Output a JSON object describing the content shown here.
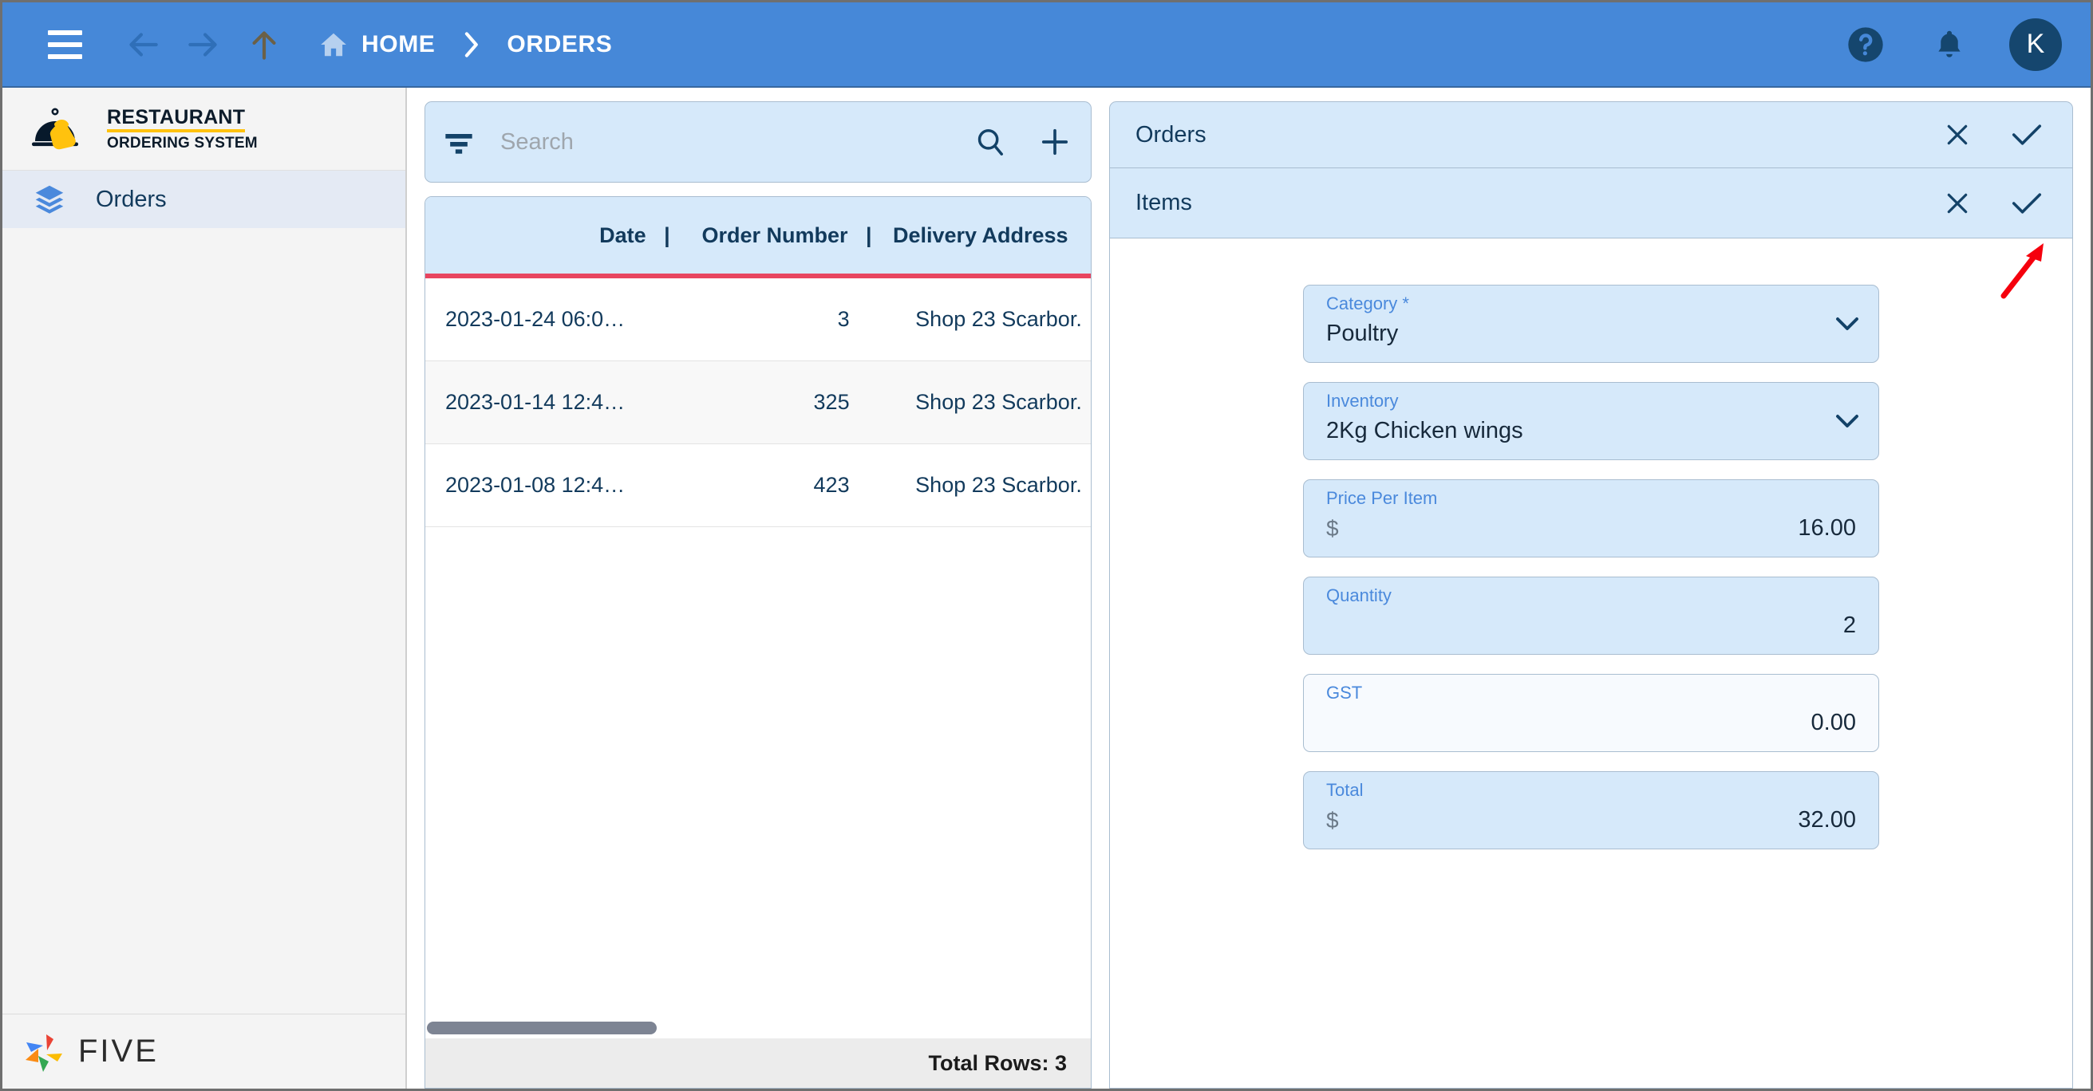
{
  "topbar": {
    "menu_icon": "hamburger-icon",
    "back_icon": "arrow-left-icon",
    "forward_icon": "arrow-right-icon",
    "up_icon": "arrow-up-icon",
    "home_icon": "home-icon",
    "breadcrumb": [
      "HOME",
      "ORDERS"
    ],
    "separator": ">",
    "help_icon": "help-circle-icon",
    "notifications_icon": "bell-icon",
    "avatar_initial": "K",
    "background_color": "#4688d8",
    "avatar_color": "#15466e"
  },
  "sidebar": {
    "logo": {
      "icon": "cloche-hand-icon",
      "line1": "RESTAURANT",
      "line2": "ORDERING SYSTEM",
      "underline_color": "#ffc20e"
    },
    "items": [
      {
        "icon": "layers-icon",
        "label": "Orders",
        "active": true
      }
    ],
    "footer_logo": {
      "icon": "five-pinwheel-icon",
      "text": "FIVE"
    }
  },
  "list_panel": {
    "search": {
      "filter_icon": "filter-icon",
      "placeholder": "Search",
      "value": "",
      "search_icon": "search-icon",
      "add_icon": "plus-icon"
    },
    "table": {
      "columns": [
        "Date",
        "Order Number",
        "Delivery Address"
      ],
      "column_separator": "|",
      "accent_color": "#e8455f",
      "rows": [
        {
          "date": "2023-01-24 06:0…",
          "order_number": "3",
          "delivery_address": "Shop 23 Scarbor."
        },
        {
          "date": "2023-01-14 12:4…",
          "order_number": "325",
          "delivery_address": "Shop 23 Scarbor."
        },
        {
          "date": "2023-01-08 12:4…",
          "order_number": "423",
          "delivery_address": "Shop 23 Scarbor."
        }
      ],
      "footer": "Total Rows: 3"
    }
  },
  "detail_panel": {
    "orders_panel": {
      "title": "Orders",
      "cancel_icon": "close-x-icon",
      "confirm_icon": "checkmark-icon"
    },
    "items_panel": {
      "title": "Items",
      "cancel_icon": "close-x-icon",
      "confirm_icon": "checkmark-icon"
    },
    "fields": [
      {
        "label": "Category *",
        "value": "Poultry",
        "type": "select",
        "currency": "",
        "readonly": false
      },
      {
        "label": "Inventory",
        "value": "2Kg Chicken wings",
        "type": "select",
        "currency": "",
        "readonly": false
      },
      {
        "label": "Price Per Item",
        "value": "16.00",
        "type": "currency",
        "currency": "$",
        "readonly": false
      },
      {
        "label": "Quantity",
        "value": "2",
        "type": "number",
        "currency": "",
        "readonly": false
      },
      {
        "label": "GST",
        "value": "0.00",
        "type": "number",
        "currency": "",
        "readonly": true
      },
      {
        "label": "Total",
        "value": "32.00",
        "type": "currency",
        "currency": "$",
        "readonly": false
      }
    ]
  },
  "annotation": {
    "arrow_color": "#f5000d",
    "points_to": "items-panel-confirm-icon"
  }
}
